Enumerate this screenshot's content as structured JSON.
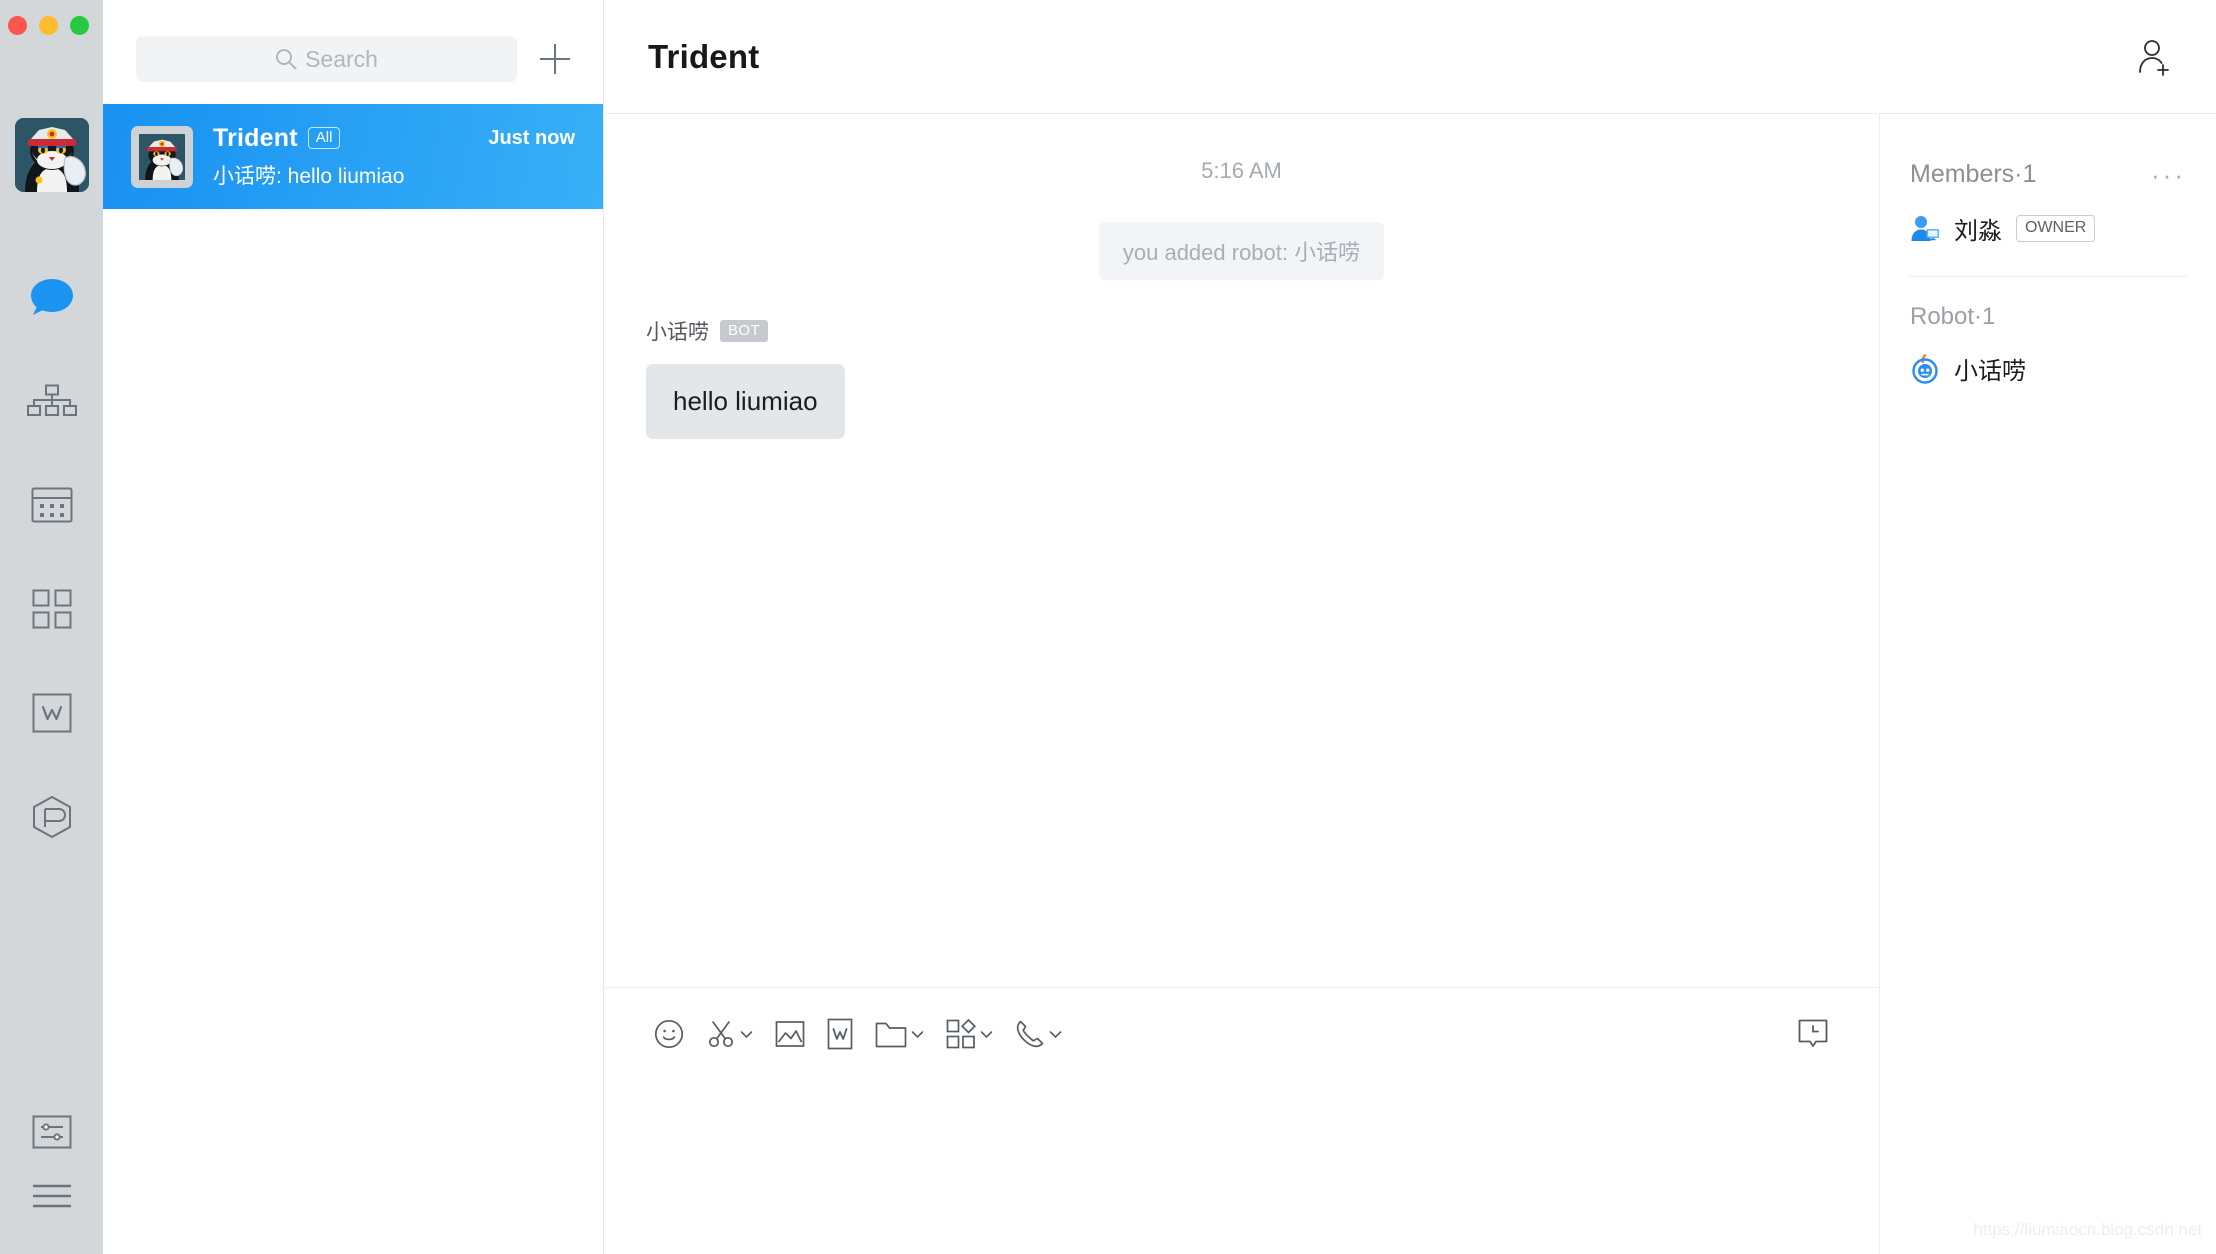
{
  "window": {
    "traffic_lights": [
      "close",
      "minimize",
      "zoom"
    ],
    "colors": {
      "close": "#f9564f",
      "minimize": "#fbbd2e",
      "zoom": "#27c93f",
      "accent": "#1891f2",
      "rail_bg": "#d3d7da"
    }
  },
  "rail": {
    "avatar_alt": "cat-captain-avatar",
    "items": [
      {
        "name": "chat",
        "icon": "chat-bubble-icon",
        "active": true
      },
      {
        "name": "contacts",
        "icon": "org-chart-icon",
        "active": false
      },
      {
        "name": "calendar",
        "icon": "calendar-icon",
        "active": false
      },
      {
        "name": "apps",
        "icon": "grid-apps-icon",
        "active": false
      },
      {
        "name": "docs",
        "icon": "w-document-icon",
        "active": false
      },
      {
        "name": "workspace",
        "icon": "hexagon-cube-icon",
        "active": false
      }
    ],
    "bottom_items": [
      {
        "name": "settings",
        "icon": "sliders-box-icon"
      },
      {
        "name": "more",
        "icon": "hamburger-menu-icon"
      }
    ]
  },
  "search": {
    "placeholder": "Search",
    "icon": "search-icon",
    "add_icon": "plus-icon"
  },
  "conversations": [
    {
      "title": "Trident",
      "tag": "All",
      "time": "Just now",
      "preview": "小话唠: hello liumiao",
      "selected": true,
      "avatar_alt": "cat-captain-avatar"
    }
  ],
  "chat": {
    "title": "Trident",
    "add_member_icon": "add-person-icon",
    "time_divider": "5:16 AM",
    "system_message": "you added robot: 小话唠",
    "messages": [
      {
        "sender": "小话唠",
        "badge": "BOT",
        "text": "hello liumiao"
      }
    ]
  },
  "toolbar": {
    "items": [
      {
        "name": "emoji",
        "icon": "smiley-icon",
        "caret": false
      },
      {
        "name": "screenshot",
        "icon": "scissors-icon",
        "caret": true
      },
      {
        "name": "image",
        "icon": "picture-icon",
        "caret": false
      },
      {
        "name": "document",
        "icon": "w-document-icon",
        "caret": false
      },
      {
        "name": "file",
        "icon": "folder-icon",
        "caret": true
      },
      {
        "name": "widgets",
        "icon": "apps-diamond-icon",
        "caret": true
      },
      {
        "name": "call",
        "icon": "phone-icon",
        "caret": true
      }
    ],
    "right_item": {
      "name": "history",
      "icon": "history-bubble-icon"
    }
  },
  "members_panel": {
    "title": "Members·1",
    "more_icon": "ellipsis-icon",
    "members": [
      {
        "name": "刘淼",
        "badge": "OWNER",
        "avatar": "person-monitor-icon"
      }
    ],
    "robot_title": "Robot·1",
    "robots": [
      {
        "name": "小话唠",
        "avatar": "robot-head-icon"
      }
    ]
  },
  "watermark": "https://liumiaocn.blog.csdn.net"
}
